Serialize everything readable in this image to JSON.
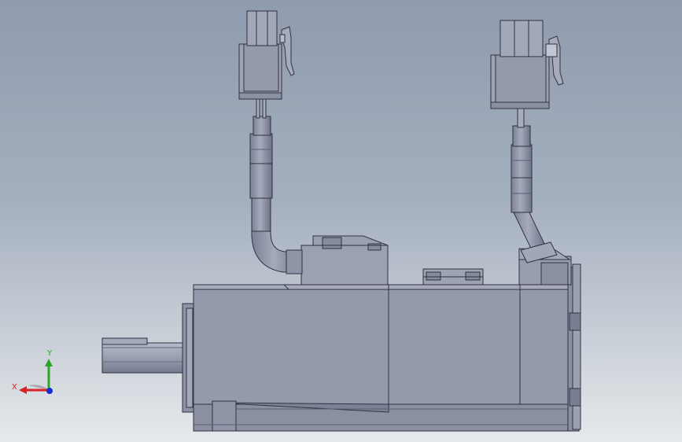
{
  "viewport": {
    "background_top": "#8f9bae",
    "background_bottom": "#e6e9ec"
  },
  "model": {
    "body_color": "#9499ab",
    "edge_color": "#2f3240",
    "shade_color": "#7f8499",
    "highlight_color": "#b4b8c8"
  },
  "triad": {
    "x_label": "X",
    "y_label": "Y",
    "x_color": "#d8232a",
    "y_color": "#2aa52a",
    "z_color": "#1b2ccf"
  }
}
